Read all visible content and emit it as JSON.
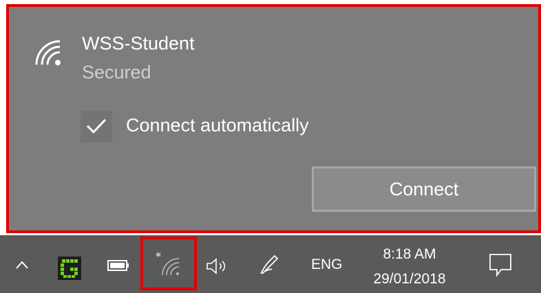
{
  "network": {
    "ssid": "WSS-Student",
    "status": "Secured",
    "connect_auto_label": "Connect automatically",
    "connect_auto_checked": true,
    "connect_button": "Connect",
    "icon": "wifi-secured-icon"
  },
  "taskbar": {
    "icons": [
      "chevron-up-icon",
      "app-g-icon",
      "battery-icon",
      "wifi-icon",
      "volume-icon",
      "pen-icon",
      "notification-icon"
    ],
    "language": "ENG",
    "time": "8:18 AM",
    "date": "29/01/2018"
  },
  "colors": {
    "flyout_bg": "#7d7d7d",
    "taskbar_bg": "#5a5a5a",
    "highlight": "#e00000",
    "app_accent": "#6fd21a"
  }
}
